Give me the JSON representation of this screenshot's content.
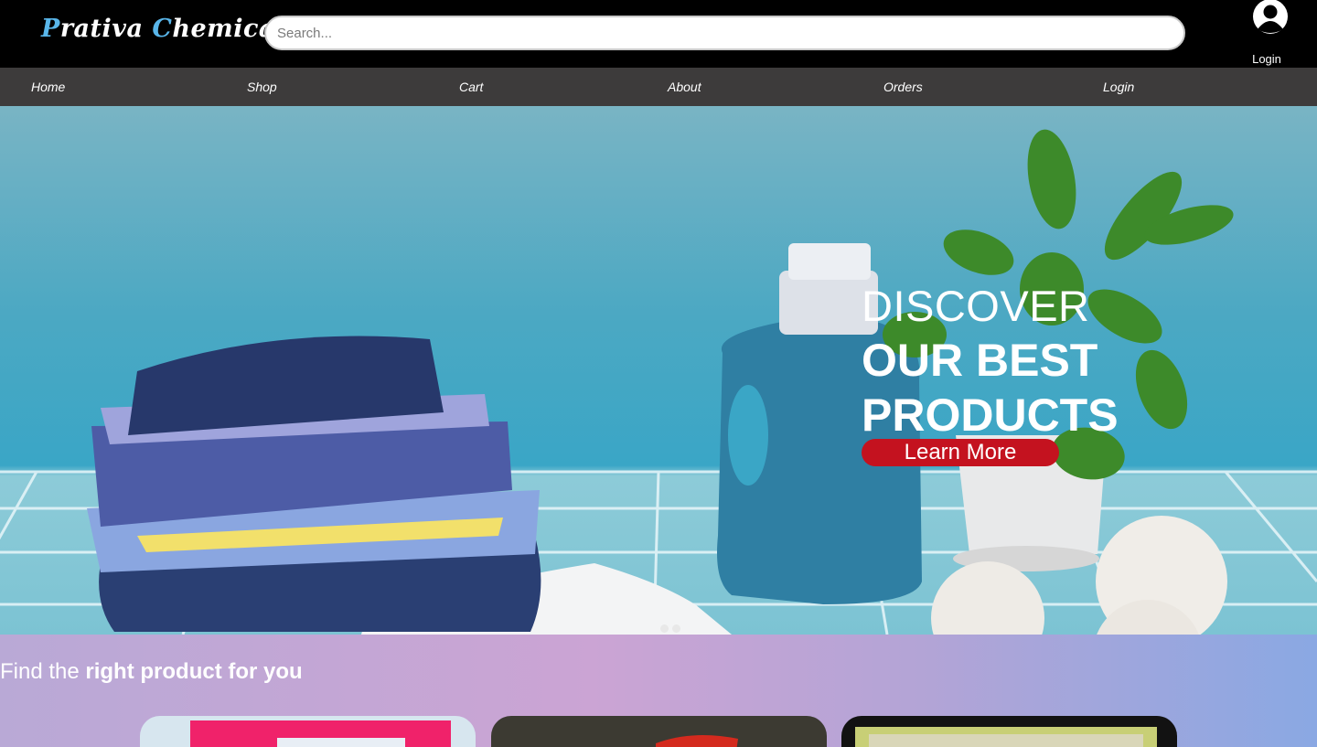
{
  "header": {
    "brand_first": "Prativa",
    "brand_second": "Chemicals",
    "brand_color": "#59b6ea",
    "search_placeholder": "Search...",
    "account_icon": "user-avatar-icon",
    "account_label": "Login"
  },
  "nav": {
    "items": [
      {
        "label": "Home"
      },
      {
        "label": "Shop"
      },
      {
        "label": "Cart"
      },
      {
        "label": "About"
      },
      {
        "label": "Orders"
      },
      {
        "label": "Login"
      }
    ]
  },
  "hero": {
    "line1": "DISCOVER",
    "line2": "OUR BEST",
    "line3": "PRODUCTS",
    "cta_label": "Learn More",
    "cta_color": "#c4121f",
    "slide_count": 2,
    "active_slide": 1
  },
  "section": {
    "title_plain": "Find the",
    "title_bold": "right product for you",
    "card_count": 3
  }
}
